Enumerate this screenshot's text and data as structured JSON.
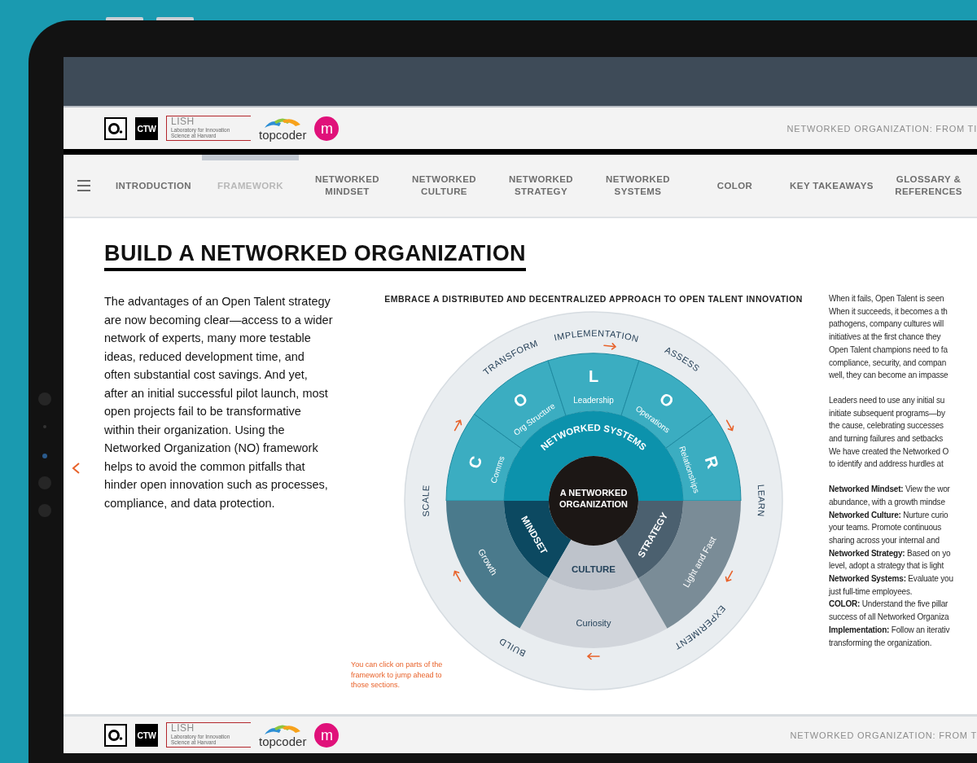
{
  "header": {
    "logos": [
      {
        "kind": "ring"
      },
      {
        "kind": "ctw",
        "text": "CTW"
      },
      {
        "kind": "lish",
        "text": "LISH",
        "subtitle": "Laboratory for Innovation Science at Harvard"
      },
      {
        "kind": "topcoder",
        "text": "topcoder"
      },
      {
        "kind": "circle",
        "text": "m"
      }
    ],
    "title": "NETWORKED ORGANIZATION: FROM TI"
  },
  "nav": {
    "items": [
      {
        "label": "INTRODUCTION",
        "selected": false
      },
      {
        "label": "FRAMEWORK",
        "selected": true
      },
      {
        "label": "NETWORKED MINDSET",
        "selected": false
      },
      {
        "label": "NETWORKED CULTURE",
        "selected": false
      },
      {
        "label": "NETWORKED STRATEGY",
        "selected": false
      },
      {
        "label": "NETWORKED SYSTEMS",
        "selected": false
      },
      {
        "label": "COLOR",
        "selected": false
      },
      {
        "label": "KEY TAKEAWAYS",
        "selected": false
      },
      {
        "label": "GLOSSARY & REFERENCES",
        "selected": false
      }
    ]
  },
  "page": {
    "title": "BUILD A NETWORKED ORGANIZATION",
    "intro": "The advantages of an Open Talent strategy are now becoming clear—access to a wider network of experts, many more testable ideas, reduced development time, and often substantial cost savings. And yet, after an initial successful pilot launch, most open projects fail to be transformative within their organization. Using the Networked Organization (NO) framework helps to avoid the common pitfalls that hinder open innovation such as processes, compliance, and data protection.",
    "framework": {
      "title": "EMBRACE A DISTRIBUTED AND DECENTRALIZED APPROACH TO OPEN TALENT INNOVATION",
      "stages": [
        "IMPLEMENTATION",
        "ASSESS",
        "LEARN",
        "EXPERIMENT",
        "BUILD",
        "SCALE",
        "TRANSFORM"
      ],
      "pillars": [
        {
          "letter": "C",
          "label": "Comms"
        },
        {
          "letter": "O",
          "label": "Org Structure"
        },
        {
          "letter": "L",
          "label": "Leadership"
        },
        {
          "letter": "O",
          "label": "Operations"
        },
        {
          "letter": "R",
          "label": "Relationships"
        }
      ],
      "systems_label": "NETWORKED SYSTEMS",
      "sections": [
        {
          "kind": "mindset",
          "label": "MINDSET",
          "trait": "Growth"
        },
        {
          "kind": "culture",
          "label": "CULTURE",
          "trait": "Curiosity"
        },
        {
          "kind": "strategy",
          "label": "STRATEGY",
          "trait": "Light and Fast"
        }
      ],
      "center_lines": [
        "A NETWORKED",
        "ORGANIZATION"
      ],
      "note": "You can click on parts of the framework to jump ahead to those sections."
    },
    "side_text": [
      [
        "When it fails, Open Talent is seen",
        "When it succeeds, it becomes a th",
        "pathogens, company cultures will",
        "initiatives at the first chance they",
        "Open Talent champions need to fa",
        "compliance, security, and compan",
        "well, they can become an impasse"
      ],
      [
        "Leaders need to use any initial su",
        "initiate subsequent programs—by",
        "the cause, celebrating successes",
        "and turning failures and setbacks",
        "We have created the Networked O",
        "to identify and address hurdles at"
      ],
      [
        "**Networked Mindset:** View the wor",
        "abundance, with a growth mindse",
        "**Networked Culture:** Nurture curio",
        "your teams. Promote continuous",
        "sharing across your internal and",
        "**Networked Strategy:** Based on yo",
        "level, adopt a strategy that is light",
        "**Networked Systems:** Evaluate you",
        "just full-time employees.",
        "**COLOR:** Understand the five pillar",
        "success of all Networked Organiza",
        "**Implementation:** Follow an iterativ",
        "transforming the organization."
      ]
    ]
  },
  "footer": {
    "logos": [
      {
        "kind": "ring"
      },
      {
        "kind": "ctw",
        "text": "CTW"
      },
      {
        "kind": "lish",
        "text": "LISH",
        "subtitle": "Laboratory for Innovation Science at Harvard"
      },
      {
        "kind": "topcoder",
        "text": "topcoder"
      },
      {
        "kind": "circle",
        "text": "m"
      }
    ],
    "title": "NETWORKED ORGANIZATION: FROM T"
  }
}
